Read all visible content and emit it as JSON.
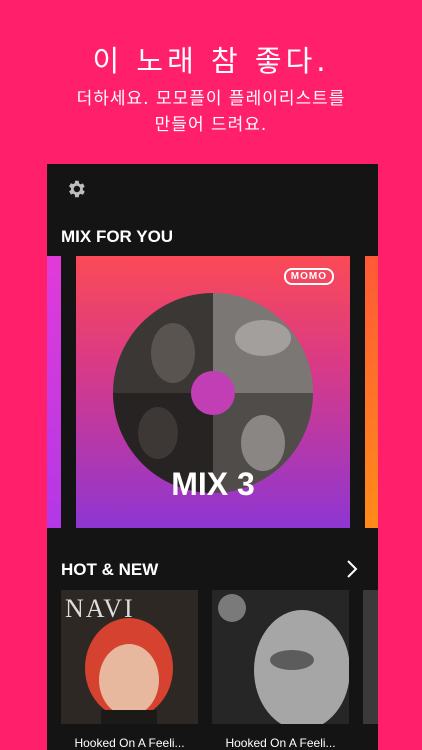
{
  "promo": {
    "headline": "이 노래 참 좋다.",
    "subline_1": "더하세요. 모모플이 플레이리스트를",
    "subline_2": "만들어 드려요."
  },
  "app": {
    "settings_icon": "gear-icon",
    "mix_section": {
      "title": "MIX FOR YOU",
      "card": {
        "logo": "MOMO",
        "label": "MIX 3"
      }
    },
    "hot_section": {
      "title": "HOT & NEW",
      "more_icon": "chevron-right-icon",
      "albums": [
        {
          "cover_text": "NAVI",
          "title": "Hooked On A Feeli..."
        },
        {
          "title": "Hooked On A Feeli..."
        }
      ]
    }
  },
  "colors": {
    "background": "#ff1f6b",
    "app_bg": "#141414",
    "mix_gradient_top": "#fb4a56",
    "mix_gradient_bottom": "#8e36d2"
  }
}
